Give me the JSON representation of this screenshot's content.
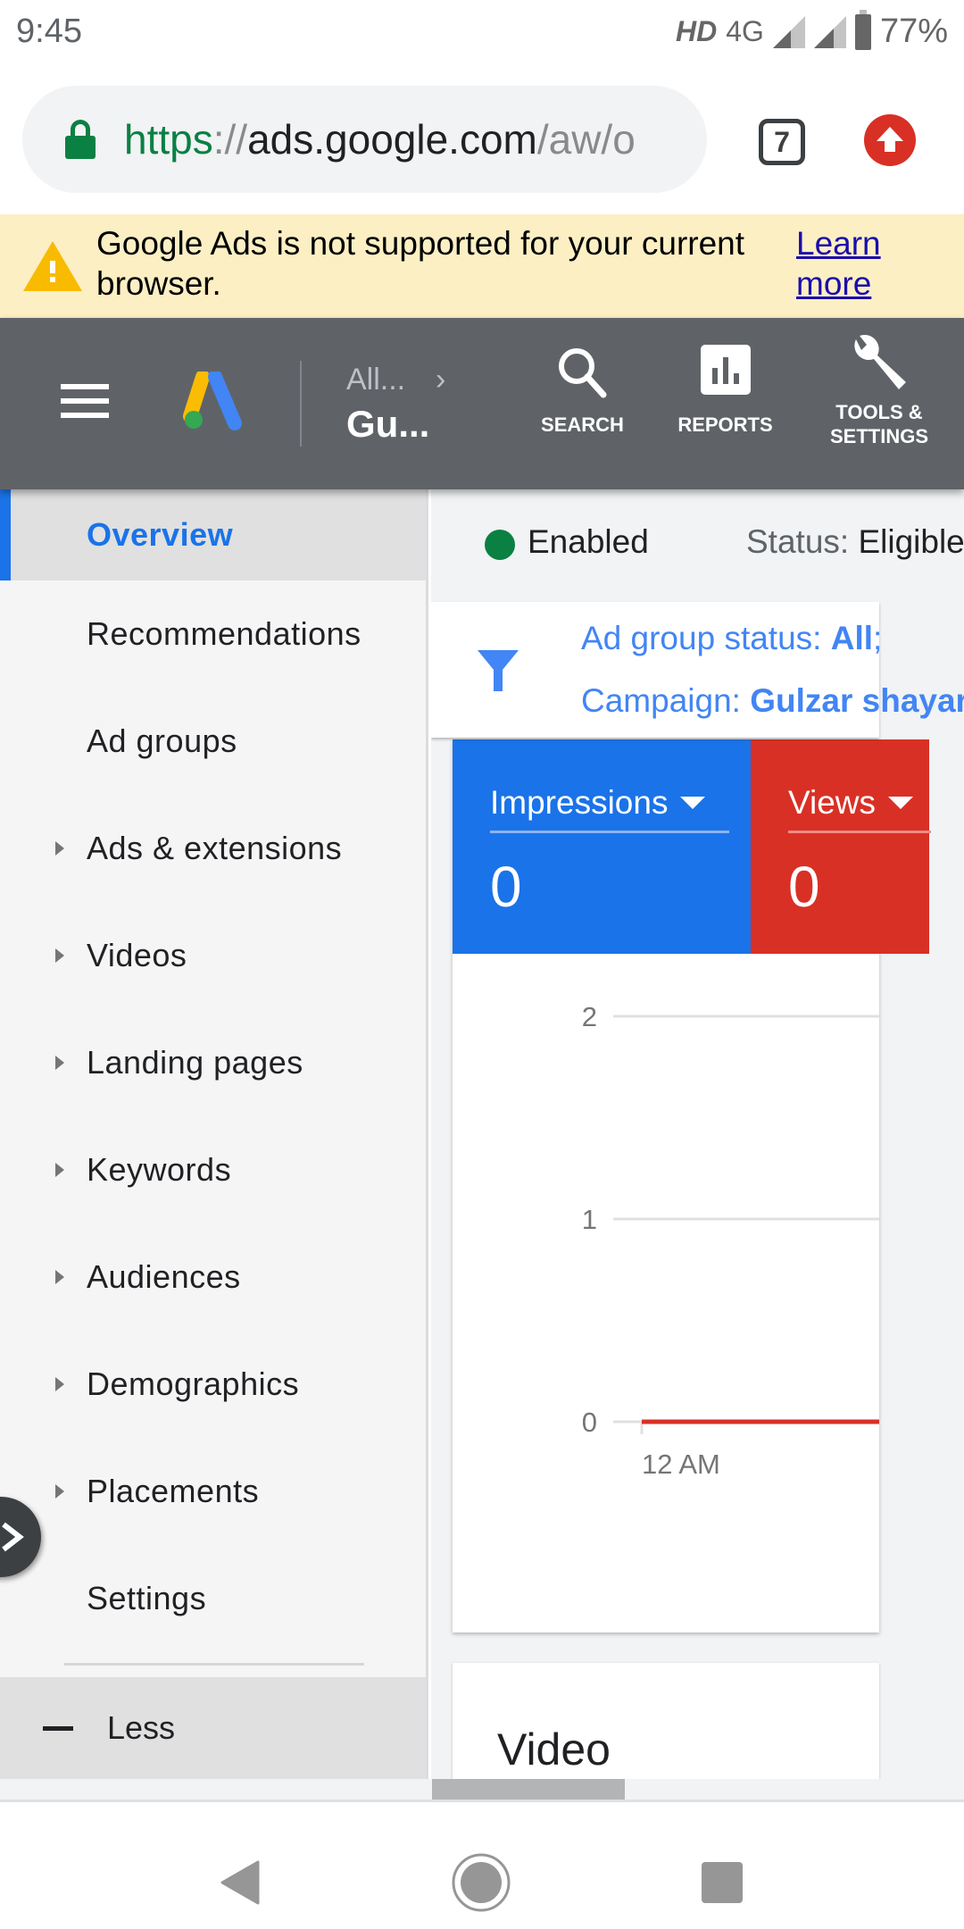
{
  "status_bar": {
    "time": "9:45",
    "hd": "HD",
    "network": "4G",
    "battery": "77%"
  },
  "browser": {
    "url_scheme": "https",
    "url_sep": "://",
    "url_host": "ads.google.com",
    "url_path": "/aw/o",
    "tab_count": "7"
  },
  "warning": {
    "message": "Google Ads is not supported for your current browser.",
    "link": "Learn more"
  },
  "header": {
    "breadcrumb_top": "All...",
    "breadcrumb_bottom": "Gu...",
    "search_label": "SEARCH",
    "reports_label": "REPORTS",
    "tools_label_1": "TOOLS &",
    "tools_label_2": "SETTINGS"
  },
  "sidebar": {
    "items": [
      {
        "label": "Overview",
        "active": true,
        "expandable": false
      },
      {
        "label": "Recommendations",
        "expandable": false
      },
      {
        "label": "Ad groups",
        "expandable": false
      },
      {
        "label": "Ads & extensions",
        "expandable": true
      },
      {
        "label": "Videos",
        "expandable": true
      },
      {
        "label": "Landing pages",
        "expandable": true
      },
      {
        "label": "Keywords",
        "expandable": true
      },
      {
        "label": "Audiences",
        "expandable": true
      },
      {
        "label": "Demographics",
        "expandable": true
      },
      {
        "label": "Placements",
        "expandable": true
      },
      {
        "label": "Settings",
        "expandable": false
      }
    ],
    "less_label": "Less"
  },
  "content": {
    "enabled_label": "Enabled",
    "status_prefix": "Status: ",
    "status_value": "Eligible",
    "filter": {
      "line1_prefix": "Ad group status: ",
      "line1_value": "All",
      "line1_suffix": ";",
      "line2_prefix": "Campaign: ",
      "line2_value": "Gulzar shayari"
    },
    "metrics": [
      {
        "label": "Impressions",
        "value": "0",
        "color": "#1a73e8"
      },
      {
        "label": "Views",
        "value": "0",
        "color": "#d93025"
      }
    ],
    "video_title": "Video"
  },
  "chart_data": {
    "type": "line",
    "title": "",
    "xlabel": "",
    "ylabel": "",
    "x": [
      "12 AM"
    ],
    "ylim": [
      0,
      2
    ],
    "yticks": [
      "0",
      "1",
      "2"
    ],
    "grid": true,
    "series": [
      {
        "name": "Impressions",
        "color": "#1a73e8",
        "values": [
          0
        ]
      },
      {
        "name": "Views",
        "color": "#d93025",
        "values": [
          0
        ]
      }
    ]
  }
}
